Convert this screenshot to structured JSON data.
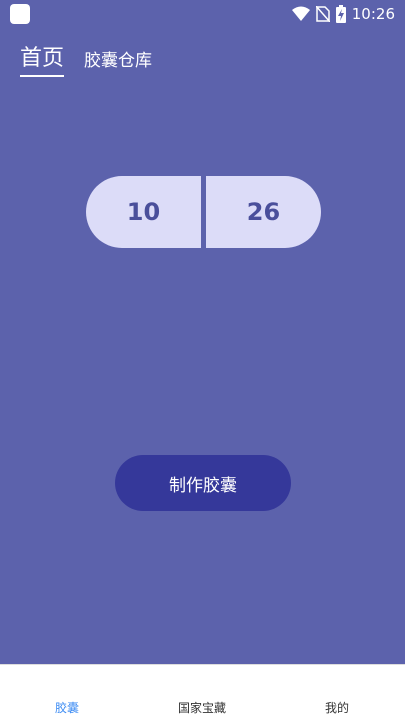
{
  "status_bar": {
    "time": "10:26"
  },
  "tabs": [
    {
      "label": "首页"
    },
    {
      "label": "胶囊仓库"
    }
  ],
  "capsule": {
    "left_value": "10",
    "right_value": "26"
  },
  "make_button": {
    "label": "制作胶囊"
  },
  "bottom_nav": [
    {
      "label": "胶囊"
    },
    {
      "label": "国家宝藏"
    },
    {
      "label": "我的"
    }
  ],
  "colors": {
    "background": "#5c62ac",
    "capsule": "#dcdcf8",
    "button": "#35389a",
    "nav_active": "#3f8df3"
  }
}
